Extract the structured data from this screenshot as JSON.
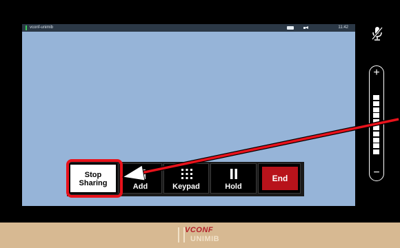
{
  "topbar": {
    "title": "vconf-unimib",
    "time": "11:42"
  },
  "buttons": {
    "stop_sharing": "Stop Sharing",
    "add": "Add",
    "keypad": "Keypad",
    "hold": "Hold",
    "end": "End"
  },
  "volume": {
    "plus": "+",
    "minus": "−",
    "level_bars": 10
  },
  "footer": {
    "logo_line1": "VCONF",
    "logo_line2": "UNIMIB"
  },
  "colors": {
    "video_area": "#96b4d8",
    "end_button": "#b8131b",
    "highlight": "#e8121b",
    "footer_bg": "#d7b992"
  },
  "icons": {
    "mute": "mic-muted-icon",
    "camera": "camera-icon",
    "speaker": "speaker-icon",
    "add": "add-participant-icon",
    "keypad": "keypad-icon",
    "hold": "pause-icon"
  }
}
